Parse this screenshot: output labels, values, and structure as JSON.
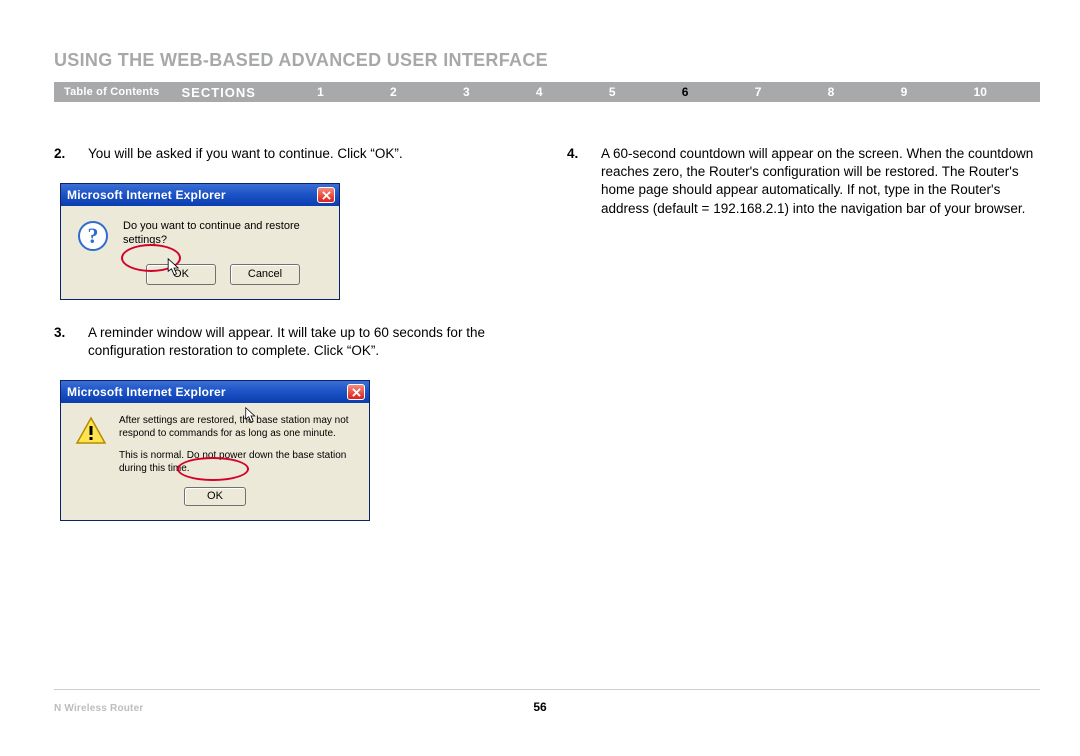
{
  "title": "USING THE WEB-BASED ADVANCED USER INTERFACE",
  "nav": {
    "toc": "Table of Contents",
    "sections_label": "SECTIONS",
    "numbers": [
      "1",
      "2",
      "3",
      "4",
      "5",
      "6",
      "7",
      "8",
      "9",
      "10"
    ],
    "active_index": 5
  },
  "steps": {
    "s2": {
      "num": "2.",
      "text": "You will be asked if you want to continue. Click “OK”."
    },
    "s3": {
      "num": "3.",
      "text": "A reminder window will appear. It will take up to 60 seconds for the configuration restoration to complete. Click “OK”."
    },
    "s4": {
      "num": "4.",
      "text": "A 60-second countdown will appear on the screen. When the countdown reaches zero, the Router's configuration will be restored. The Router's home page should appear automatically. If not, type in the Router's address (default = 192.168.2.1) into the navigation bar of your browser."
    }
  },
  "dialog1": {
    "title": "Microsoft Internet Explorer",
    "message": "Do you want to continue and restore settings?",
    "ok": "OK",
    "cancel": "Cancel"
  },
  "dialog2": {
    "title": "Microsoft Internet Explorer",
    "line1": "After settings are restored, the base station may not respond to commands for as long as one minute.",
    "line2": "This is normal. Do not power down the base station during this time.",
    "ok": "OK"
  },
  "footer": {
    "product": "N Wireless Router",
    "page": "56"
  }
}
